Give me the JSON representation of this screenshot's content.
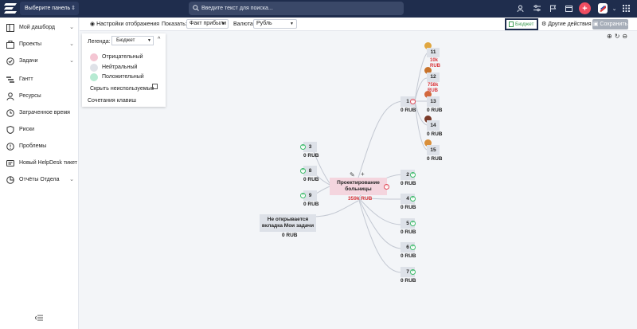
{
  "topbar": {
    "panel_select": "Выберите панель",
    "search_placeholder": "Введите текст для поиска..."
  },
  "sidebar": {
    "items": [
      {
        "label": "Мой дашборд",
        "chevron": true
      },
      {
        "label": "Проекты",
        "chevron": true
      },
      {
        "label": "Задачи",
        "chevron": true
      },
      {
        "label": "Гантт",
        "chevron": false
      },
      {
        "label": "Ресурсы",
        "chevron": false
      },
      {
        "label": "Затраченное время",
        "chevron": false
      },
      {
        "label": "Риски",
        "chevron": false
      },
      {
        "label": "Проблемы",
        "chevron": false
      },
      {
        "label": "Новый HelpDesk тикет",
        "chevron": false
      },
      {
        "label": "Отчёты Отдела",
        "chevron": true
      }
    ]
  },
  "toolbar": {
    "display_settings": "Настройки отображения",
    "show_label": "Показать:",
    "show_value": "Факт прибыли",
    "currency_label": "Валюта:",
    "currency_value": "Рубль",
    "budget_button": "Бюджет",
    "other_actions": "Другие действия",
    "save_button": "Сохранить"
  },
  "legend": {
    "title": "Легенда:",
    "select_value": "Бюджет",
    "items": [
      {
        "label": "Отрицательный",
        "color": "#f4c6d3"
      },
      {
        "label": "Нейтральный",
        "color": "#dfe2e8"
      },
      {
        "label": "Положительный",
        "color": "#b6ead2"
      }
    ],
    "hide_unused": "Скрыть неиспользуемые",
    "shortcuts": "Сочетания клавиш"
  },
  "mindmap": {
    "root": {
      "title": "Проектирование больницы",
      "value": "359k RUB"
    },
    "branch_1": {
      "label": "1",
      "value": "0 RUB"
    },
    "children_1": [
      {
        "label": "11",
        "value": "10k RUB"
      },
      {
        "label": "12",
        "value": "758k RUB"
      },
      {
        "label": "13",
        "value": "0 RUB"
      },
      {
        "label": "14",
        "value": "0 RUB"
      },
      {
        "label": "15",
        "value": "0 RUB"
      }
    ],
    "right": [
      {
        "label": "2",
        "value": "0 RUB"
      },
      {
        "label": "4",
        "value": "0 RUB"
      },
      {
        "label": "5",
        "value": "0 RUB"
      },
      {
        "label": "6",
        "value": "0 RUB"
      },
      {
        "label": "7",
        "value": "0 RUB"
      }
    ],
    "left": [
      {
        "label": "3",
        "value": "0 RUB"
      },
      {
        "label": "8",
        "value": "0 RUB"
      },
      {
        "label": "9",
        "value": "0 RUB"
      }
    ],
    "orphan": {
      "title": "Не открывается вкладка Мои задачи",
      "value": "0 RUB"
    }
  }
}
